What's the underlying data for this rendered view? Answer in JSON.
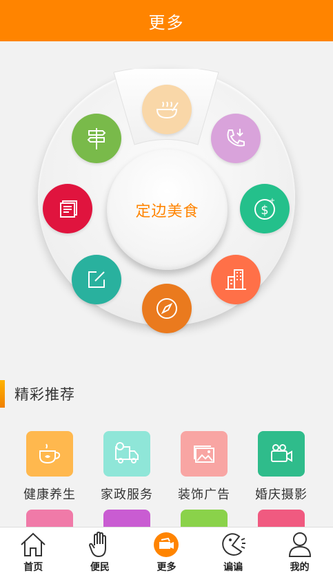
{
  "header": {
    "title": "更多"
  },
  "wheel": {
    "center_label": "定边美食",
    "spokes": [
      {
        "icon": "food-bowl-icon",
        "color": "#f9d7a8"
      },
      {
        "icon": "phone-icon",
        "color": "#d9a3db"
      },
      {
        "icon": "dollar-icon",
        "color": "#24c08b"
      },
      {
        "icon": "building-icon",
        "color": "#ff7048"
      },
      {
        "icon": "compass-icon",
        "color": "#ea7a1e"
      },
      {
        "icon": "edit-icon",
        "color": "#29b19e"
      },
      {
        "icon": "news-icon",
        "color": "#e0143e"
      },
      {
        "icon": "signpost-icon",
        "color": "#79ba4a"
      }
    ]
  },
  "recommend": {
    "title": "精彩推荐",
    "items": [
      {
        "label": "健康养生",
        "icon": "teacup-icon",
        "color": "#ffb84e"
      },
      {
        "label": "家政服务",
        "icon": "truck-icon",
        "color": "#8fe6d8"
      },
      {
        "label": "装饰广告",
        "icon": "picture-icon",
        "color": "#f8a5a3"
      },
      {
        "label": "婚庆摄影",
        "icon": "video-camera-icon",
        "color": "#2fbc8b"
      }
    ],
    "more_colors": [
      "#f07aa8",
      "#c95cd2",
      "#8ad24a",
      "#f05a80"
    ]
  },
  "bottom_nav": [
    {
      "label": "首页",
      "icon": "home-icon"
    },
    {
      "label": "便民",
      "icon": "hand-icon"
    },
    {
      "label": "更多",
      "icon": "more-icon",
      "active": true
    },
    {
      "label": "谝谝",
      "icon": "chat-icon"
    },
    {
      "label": "我的",
      "icon": "user-icon"
    }
  ]
}
